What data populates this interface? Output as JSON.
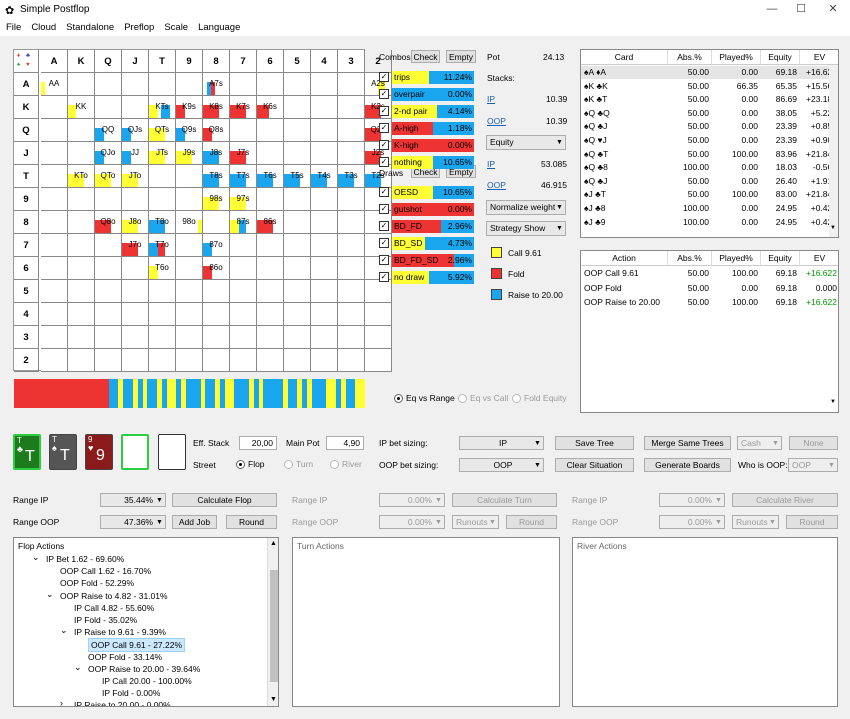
{
  "window": {
    "title": "Simple Postflop",
    "min": "—",
    "max": "☐",
    "close": "✕"
  },
  "menu": [
    "File",
    "Cloud",
    "Standalone",
    "Preflop",
    "Scale",
    "Language"
  ],
  "colors": {
    "call": "#ffff33",
    "fold": "#ee3333",
    "raise": "#1aa6ee",
    "positive": "#009900"
  },
  "ranks": [
    "A",
    "K",
    "Q",
    "J",
    "T",
    "9",
    "8",
    "7",
    "6",
    "5",
    "4",
    "3",
    "2"
  ],
  "matrix_cells": [
    {
      "label": "AA",
      "r": 0,
      "c": 0,
      "s": [
        [
          0,
          0,
          0.14
        ]
      ]
    },
    {
      "label": "A7s",
      "r": 0,
      "c": 6,
      "s": [
        [
          1,
          0.3,
          0.15
        ],
        [
          2,
          0.15,
          0.15
        ]
      ]
    },
    {
      "label": "A2s",
      "r": 0,
      "c": 12,
      "s": [
        [
          0,
          0.5,
          0.25
        ]
      ]
    },
    {
      "label": "KK",
      "r": 1,
      "c": 1,
      "s": [
        [
          0,
          0,
          0.3
        ]
      ]
    },
    {
      "label": "KTs",
      "r": 1,
      "c": 4,
      "s": [
        [
          0,
          0,
          0.35
        ],
        [
          2,
          0.45,
          0.35
        ]
      ]
    },
    {
      "label": "K9s",
      "r": 1,
      "c": 5,
      "s": [
        [
          1,
          0,
          0.35
        ]
      ]
    },
    {
      "label": "K8s",
      "r": 1,
      "c": 6,
      "s": [
        [
          1,
          0,
          0.6
        ]
      ]
    },
    {
      "label": "K7s",
      "r": 1,
      "c": 7,
      "s": [
        [
          1,
          0,
          0.6
        ]
      ]
    },
    {
      "label": "K6s",
      "r": 1,
      "c": 8,
      "s": [
        [
          1,
          0,
          0.45
        ]
      ]
    },
    {
      "label": "K2s",
      "r": 1,
      "c": 12,
      "s": [
        [
          1,
          0,
          0.6
        ]
      ]
    },
    {
      "label": "QQ",
      "r": 2,
      "c": 2,
      "s": [
        [
          2,
          0,
          0.35
        ]
      ]
    },
    {
      "label": "QJs",
      "r": 2,
      "c": 3,
      "s": [
        [
          2,
          0,
          0.35
        ]
      ]
    },
    {
      "label": "QTs",
      "r": 2,
      "c": 4,
      "s": [
        [
          0,
          0,
          0.6
        ]
      ]
    },
    {
      "label": "Q9s",
      "r": 2,
      "c": 5,
      "s": [
        [
          2,
          0,
          0.35
        ]
      ]
    },
    {
      "label": "Q8s",
      "r": 2,
      "c": 6,
      "s": [
        [
          1,
          0,
          0.35
        ]
      ]
    },
    {
      "label": "Q2s",
      "r": 2,
      "c": 12,
      "s": [
        [
          1,
          0,
          0.6
        ]
      ]
    },
    {
      "label": "QJo",
      "r": 3,
      "c": 2,
      "s": [
        [
          2,
          0,
          0.35
        ]
      ]
    },
    {
      "label": "JJ",
      "r": 3,
      "c": 3,
      "s": [
        [
          2,
          0,
          0.35
        ]
      ]
    },
    {
      "label": "JTs",
      "r": 3,
      "c": 4,
      "s": [
        [
          0,
          0,
          0.6
        ]
      ]
    },
    {
      "label": "J9s",
      "r": 3,
      "c": 5,
      "s": [
        [
          0,
          0,
          0.6
        ]
      ]
    },
    {
      "label": "J8s",
      "r": 3,
      "c": 6,
      "s": [
        [
          2,
          0,
          0.6
        ]
      ]
    },
    {
      "label": "J7s",
      "r": 3,
      "c": 7,
      "s": [
        [
          1,
          0,
          0.6
        ]
      ]
    },
    {
      "label": "J2s",
      "r": 3,
      "c": 12,
      "s": [
        [
          1,
          0,
          0.6
        ]
      ]
    },
    {
      "label": "KTo",
      "r": 4,
      "c": 1,
      "s": [
        [
          0,
          0,
          0.6
        ]
      ]
    },
    {
      "label": "QTo",
      "r": 4,
      "c": 2,
      "s": [
        [
          0,
          0,
          0.6
        ]
      ]
    },
    {
      "label": "JTo",
      "r": 4,
      "c": 3,
      "s": [
        [
          0,
          0,
          0.6
        ]
      ]
    },
    {
      "label": "T8s",
      "r": 4,
      "c": 6,
      "s": [
        [
          2,
          0,
          0.6
        ]
      ]
    },
    {
      "label": "T7s",
      "r": 4,
      "c": 7,
      "s": [
        [
          2,
          0,
          0.6
        ]
      ]
    },
    {
      "label": "T6s",
      "r": 4,
      "c": 8,
      "s": [
        [
          2,
          0,
          0.6
        ]
      ]
    },
    {
      "label": "T5s",
      "r": 4,
      "c": 9,
      "s": [
        [
          2,
          0,
          0.6
        ]
      ]
    },
    {
      "label": "T4s",
      "r": 4,
      "c": 10,
      "s": [
        [
          2,
          0,
          0.6
        ]
      ]
    },
    {
      "label": "T3s",
      "r": 4,
      "c": 11,
      "s": [
        [
          2,
          0,
          0.6
        ]
      ]
    },
    {
      "label": "T2s",
      "r": 4,
      "c": 12,
      "s": [
        [
          2,
          0,
          0.6
        ]
      ]
    },
    {
      "label": "98s",
      "r": 5,
      "c": 6,
      "s": [
        [
          0,
          0,
          0.6
        ]
      ]
    },
    {
      "label": "97s",
      "r": 5,
      "c": 7,
      "s": [
        [
          0,
          0,
          0.6
        ]
      ]
    },
    {
      "label": "Q8o",
      "r": 6,
      "c": 2,
      "s": [
        [
          1,
          0,
          0.6
        ]
      ]
    },
    {
      "label": "J8o",
      "r": 6,
      "c": 3,
      "s": [
        [
          0,
          0,
          0.6
        ]
      ]
    },
    {
      "label": "T8o",
      "r": 6,
      "c": 4,
      "s": [
        [
          2,
          0,
          0.6
        ]
      ]
    },
    {
      "label": "98o",
      "r": 6,
      "c": 5,
      "s": [
        [
          0,
          0.85,
          0.15
        ]
      ]
    },
    {
      "label": "87s",
      "r": 6,
      "c": 7,
      "s": [
        [
          0,
          0,
          0.35
        ],
        [
          2,
          0.35,
          0.25
        ]
      ]
    },
    {
      "label": "86s",
      "r": 6,
      "c": 8,
      "s": [
        [
          1,
          0,
          0.6
        ]
      ]
    },
    {
      "label": "J7o",
      "r": 7,
      "c": 3,
      "s": [
        [
          1,
          0,
          0.6
        ]
      ]
    },
    {
      "label": "T7o",
      "r": 7,
      "c": 4,
      "s": [
        [
          2,
          0,
          0.35
        ],
        [
          1,
          0.35,
          0.25
        ]
      ]
    },
    {
      "label": "87o",
      "r": 7,
      "c": 6,
      "s": [
        [
          2,
          0,
          0.35
        ]
      ]
    },
    {
      "label": "T6o",
      "r": 8,
      "c": 4,
      "s": [
        [
          0,
          0,
          0.35
        ]
      ]
    },
    {
      "label": "86o",
      "r": 8,
      "c": 6,
      "s": [
        [
          1,
          0,
          0.35
        ]
      ]
    }
  ],
  "row_labels": [
    "A",
    "K",
    "Q",
    "J",
    "T",
    "9",
    "8",
    "7",
    "6",
    "5",
    "4",
    "3",
    "2"
  ],
  "summary_bar": {
    "fold": 0.27,
    "segments": [
      [
        2,
        "c"
      ],
      [
        1,
        "y"
      ],
      [
        2,
        "c"
      ],
      [
        1,
        "y"
      ],
      [
        1,
        "c"
      ],
      [
        1,
        "y"
      ],
      [
        2,
        "c"
      ],
      [
        1,
        "y"
      ],
      [
        1,
        "c"
      ],
      [
        2,
        "y"
      ],
      [
        1,
        "c"
      ],
      [
        1,
        "y"
      ],
      [
        3,
        "c"
      ],
      [
        1,
        "y"
      ],
      [
        2,
        "c"
      ],
      [
        1,
        "y"
      ],
      [
        1,
        "c"
      ],
      [
        2,
        "y"
      ],
      [
        3,
        "c"
      ],
      [
        1,
        "y"
      ],
      [
        1,
        "c"
      ],
      [
        1,
        "y"
      ],
      [
        4,
        "c"
      ],
      [
        1,
        "y"
      ],
      [
        2,
        "c"
      ],
      [
        1,
        "y"
      ],
      [
        1,
        "c"
      ],
      [
        1,
        "y"
      ],
      [
        3,
        "c"
      ],
      [
        2,
        "y"
      ],
      [
        1,
        "c"
      ],
      [
        1,
        "y"
      ],
      [
        2,
        "c"
      ],
      [
        2,
        "y"
      ]
    ]
  },
  "combos": {
    "label": "Combos",
    "check": "Check",
    "empty": "Empty",
    "rows": [
      {
        "name": "trips",
        "pct": "11.24%",
        "fill": [
          [
            0,
            0.45
          ],
          [
            2,
            0.55
          ]
        ]
      },
      {
        "name": "overpair",
        "pct": "0.00%",
        "fill": [
          [
            2,
            1.0
          ]
        ]
      },
      {
        "name": "2-nd pair",
        "pct": "4.14%",
        "fill": [
          [
            0,
            0.55
          ],
          [
            2,
            0.45
          ]
        ]
      },
      {
        "name": "A-high",
        "pct": "1.18%",
        "fill": [
          [
            1,
            0.5
          ],
          [
            2,
            0.5
          ]
        ]
      },
      {
        "name": "K-high",
        "pct": "0.00%",
        "fill": [
          [
            1,
            1.0
          ]
        ]
      },
      {
        "name": "nothing",
        "pct": "10.65%",
        "fill": [
          [
            0,
            0.5
          ],
          [
            2,
            0.5
          ]
        ]
      }
    ]
  },
  "draws": {
    "label": "Draws",
    "check": "Check",
    "empty": "Empty",
    "rows": [
      {
        "name": "OESD",
        "pct": "10.65%",
        "fill": [
          [
            0,
            0.5
          ],
          [
            2,
            0.5
          ]
        ]
      },
      {
        "name": "gutshot",
        "pct": "0.00%",
        "fill": [
          [
            1,
            1.0
          ]
        ]
      },
      {
        "name": "BD_FD",
        "pct": "2.96%",
        "fill": [
          [
            1,
            0.6
          ],
          [
            2,
            0.4
          ]
        ]
      },
      {
        "name": "BD_SD",
        "pct": "4.73%",
        "fill": [
          [
            0,
            0.4
          ],
          [
            2,
            0.6
          ]
        ]
      },
      {
        "name": "BD_FD_SD",
        "pct": "2.96%",
        "fill": [
          [
            1,
            0.75
          ],
          [
            2,
            0.25
          ]
        ]
      },
      {
        "name": "no draw",
        "pct": "5.92%",
        "fill": [
          [
            0,
            0.45
          ],
          [
            2,
            0.55
          ]
        ]
      }
    ]
  },
  "stats": {
    "pot_label": "Pot",
    "pot": "24.13",
    "stacks_label": "Stacks:",
    "ip": "IP",
    "ip_stack": "10.39",
    "oop": "OOP",
    "oop_stack": "10.39",
    "mode": "Equity",
    "ip_eq": "53.085",
    "oop_eq": "46.915",
    "normalize": "Normalize weight",
    "strategy": "Strategy Show"
  },
  "legend": {
    "call": "Call 9.61",
    "fold": "Fold",
    "raise": "Raise to 20.00"
  },
  "eq_radios": {
    "a": "Eq vs Range",
    "b": "Eq vs Call",
    "c": "Fold Equity"
  },
  "card_table": {
    "headers": [
      "Card",
      "Abs.%",
      "Played%",
      "Equity",
      "EV"
    ],
    "rows": [
      {
        "card": "♠A ♦A",
        "abs": "50.00",
        "played": "0.00",
        "eq": "69.18",
        "ev": "+16.622"
      },
      {
        "card": "♠K ♣K",
        "abs": "50.00",
        "played": "66.35",
        "eq": "65.35",
        "ev": "+15.563"
      },
      {
        "card": "♠K ♣T",
        "abs": "50.00",
        "played": "0.00",
        "eq": "86.69",
        "ev": "+23.186"
      },
      {
        "card": "♠Q ♣Q",
        "abs": "50.00",
        "played": "0.00",
        "eq": "38.05",
        "ev": "+5.224"
      },
      {
        "card": "♠Q ♣J",
        "abs": "50.00",
        "played": "0.00",
        "eq": "23.39",
        "ev": "+0.857"
      },
      {
        "card": "♠Q ♥J",
        "abs": "50.00",
        "played": "0.00",
        "eq": "23.39",
        "ev": "+0.901"
      },
      {
        "card": "♠Q ♣T",
        "abs": "50.00",
        "played": "100.00",
        "eq": "83.96",
        "ev": "+21.840"
      },
      {
        "card": "♠Q ♣8",
        "abs": "100.00",
        "played": "0.00",
        "eq": "18.03",
        "ev": "-0.563"
      },
      {
        "card": "♠Q ♣J",
        "abs": "50.00",
        "played": "0.00",
        "eq": "26.40",
        "ev": "+1.918"
      },
      {
        "card": "♠J ♣T",
        "abs": "50.00",
        "played": "100.00",
        "eq": "83.00",
        "ev": "+21.845"
      },
      {
        "card": "♠J ♣8",
        "abs": "100.00",
        "played": "0.00",
        "eq": "24.95",
        "ev": "+0.423"
      },
      {
        "card": "♠J ♣9",
        "abs": "100.00",
        "played": "0.00",
        "eq": "24.95",
        "ev": "+0.428"
      }
    ]
  },
  "action_table": {
    "headers": [
      "Action",
      "Abs.%",
      "Played%",
      "Equity",
      "EV"
    ],
    "rows": [
      {
        "act": "OOP Call 9.61",
        "abs": "50.00",
        "played": "100.00",
        "eq": "69.18",
        "ev": "+16.622"
      },
      {
        "act": "OOP Fold",
        "abs": "50.00",
        "played": "0.00",
        "eq": "69.18",
        "ev": "0.000"
      },
      {
        "act": "OOP Raise to 20.00",
        "abs": "50.00",
        "played": "100.00",
        "eq": "69.18",
        "ev": "+16.622"
      }
    ]
  },
  "board": {
    "cards": [
      {
        "rank": "T",
        "suit": "♣",
        "color": "#1d7a1d"
      },
      {
        "rank": "T",
        "suit": "♠",
        "color": "#555"
      },
      {
        "rank": "9",
        "suit": "♥",
        "color": "#8b1a1a"
      }
    ]
  },
  "controls": {
    "eff_stack": "Eff. Stack",
    "eff_val": "20,00",
    "main_pot": "Main Pot",
    "pot_val": "4,90",
    "street": "Street",
    "flop": "Flop",
    "turn": "Turn",
    "river": "River",
    "ip_sizing": "IP bet sizing:",
    "ip_sel": "IP",
    "oop_sizing": "OOP bet sizing:",
    "oop_sel": "OOP",
    "save_tree": "Save Tree",
    "merge": "Merge Same Trees",
    "cash": "Cash",
    "none": "None",
    "clear": "Clear Situation",
    "gen_boards": "Generate Boards",
    "who_oop": "Who is OOP:",
    "oop_val": "OOP",
    "range_ip": "Range IP",
    "range_ip_val": "35.44%",
    "range_oop": "Range OOP",
    "range_oop_val": "47.36%",
    "calc_flop": "Calculate Flop",
    "add_job": "Add Job",
    "round": "Round",
    "t_range_ip": "Range IP",
    "t_range_ip_val": "0.00%",
    "t_range_oop": "Range OOP",
    "t_range_oop_val": "0.00%",
    "calc_turn": "Calculate Turn",
    "runouts": "Runouts",
    "t_round": "Round",
    "r_range_ip": "Range IP",
    "r_range_ip_val": "0.00%",
    "r_range_oop": "Range OOP",
    "r_range_oop_val": "0.00%",
    "calc_river": "Calculate River",
    "r_runouts": "Runouts",
    "r_round": "Round"
  },
  "flop_actions": {
    "title": "Flop Actions",
    "items": [
      {
        "t": "IP Bet 1.62 - 69.60%",
        "lvl": 1,
        "arrow": "⌄"
      },
      {
        "t": "OOP Call 1.62 - 16.70%",
        "lvl": 2,
        "arrow": ""
      },
      {
        "t": "OOP Fold - 52.29%",
        "lvl": 2,
        "arrow": ""
      },
      {
        "t": "OOP Raise to 4.82 - 31.01%",
        "lvl": 2,
        "arrow": "⌄"
      },
      {
        "t": "IP Call 4.82 - 55.60%",
        "lvl": 3,
        "arrow": ""
      },
      {
        "t": "IP Fold - 35.02%",
        "lvl": 3,
        "arrow": ""
      },
      {
        "t": "IP Raise to 9.61 - 9.39%",
        "lvl": 3,
        "arrow": "⌄"
      },
      {
        "t": "OOP Call 9.61 - 27.22%",
        "lvl": 4,
        "arrow": "",
        "sel": true
      },
      {
        "t": "OOP Fold - 33.14%",
        "lvl": 4,
        "arrow": ""
      },
      {
        "t": "OOP Raise to 20.00 - 39.64%",
        "lvl": 4,
        "arrow": "⌄"
      },
      {
        "t": "IP Call 20.00 - 100.00%",
        "lvl": 5,
        "arrow": ""
      },
      {
        "t": "IP Fold - 0.00%",
        "lvl": 5,
        "arrow": ""
      },
      {
        "t": "IP Raise to 20.00 - 0.00%",
        "lvl": 3,
        "arrow": "›"
      }
    ]
  },
  "turn_actions": {
    "title": "Turn Actions"
  },
  "river_actions": {
    "title": "River Actions"
  }
}
